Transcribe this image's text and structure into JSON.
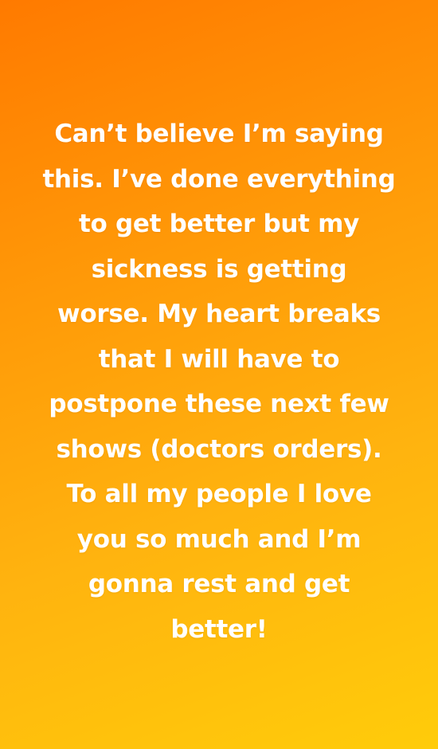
{
  "story": {
    "lines": [
      "Can’t believe I’m saying",
      "this. I’ve done everything",
      "to get better but my",
      "sickness is getting",
      "worse. My heart breaks",
      "that I will have to",
      "postpone these next few",
      "shows (doctors orders).",
      "To all my people I love",
      "you so much and I’m",
      "gonna rest and get",
      "better!"
    ]
  },
  "colors": {
    "text": "#ffffff",
    "gradient_start": "#ff7a00",
    "gradient_end": "#ffcc0a"
  }
}
